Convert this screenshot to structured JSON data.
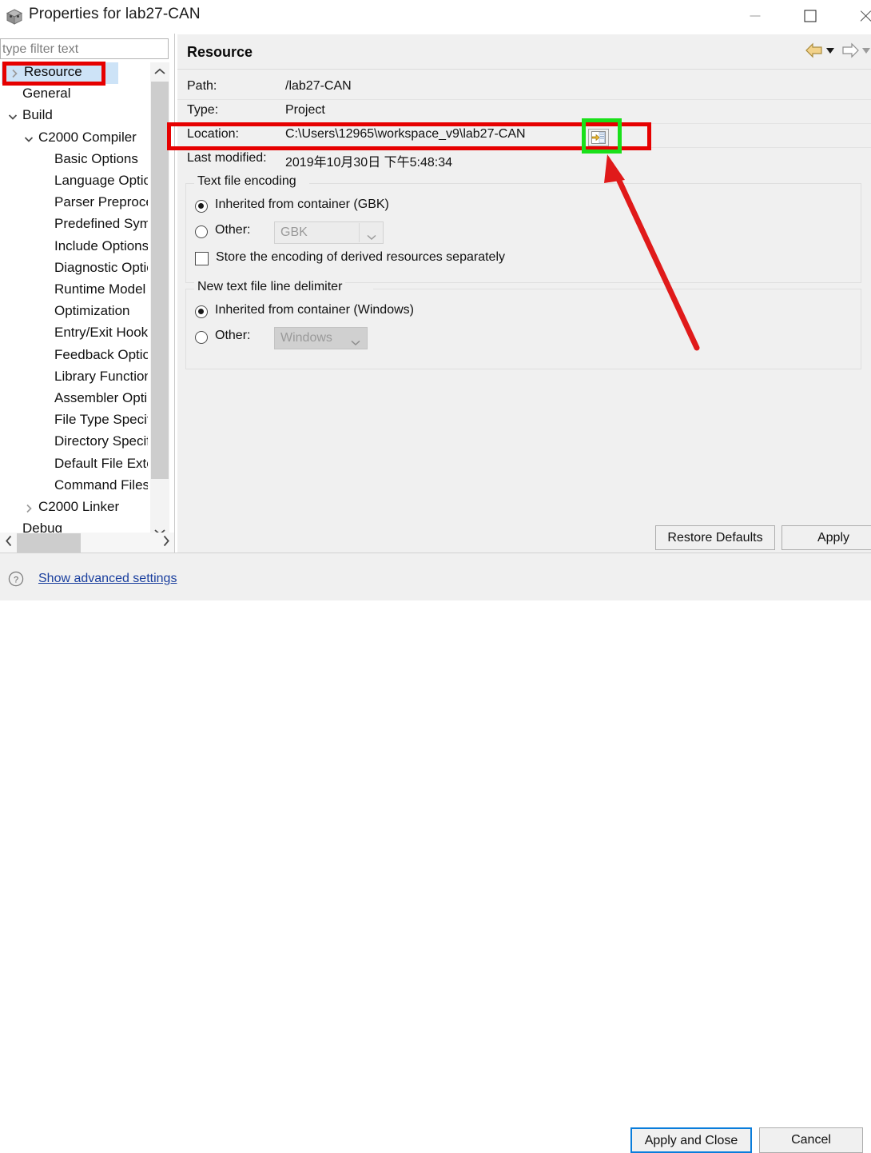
{
  "window": {
    "title": "Properties for lab27-CAN",
    "icon": "project-cube-icon",
    "controls": {
      "minimize": "minimize",
      "maximize": "maximize",
      "close": "close"
    }
  },
  "filter": {
    "placeholder": "type filter text",
    "value": ""
  },
  "tree": {
    "selected": "Resource",
    "items": [
      {
        "label": "Resource",
        "indent": 0,
        "twisty": "right",
        "selected": true
      },
      {
        "label": "General",
        "indent": 0,
        "twisty": "none",
        "selected": false
      },
      {
        "label": "Build",
        "indent": 0,
        "twisty": "down",
        "selected": false
      },
      {
        "label": "C2000 Compiler",
        "indent": 1,
        "twisty": "down",
        "selected": false
      },
      {
        "label": "Basic Options",
        "indent": 2,
        "twisty": "none",
        "selected": false
      },
      {
        "label": "Language Options",
        "indent": 2,
        "twisty": "none",
        "selected": false
      },
      {
        "label": "Parser Preprocessing",
        "indent": 2,
        "twisty": "none",
        "selected": false
      },
      {
        "label": "Predefined Symbols",
        "indent": 2,
        "twisty": "none",
        "selected": false
      },
      {
        "label": "Include Options",
        "indent": 2,
        "twisty": "none",
        "selected": false
      },
      {
        "label": "Diagnostic Options",
        "indent": 2,
        "twisty": "none",
        "selected": false
      },
      {
        "label": "Runtime Model Options",
        "indent": 2,
        "twisty": "none",
        "selected": false
      },
      {
        "label": "Optimization",
        "indent": 2,
        "twisty": "none",
        "selected": false
      },
      {
        "label": "Entry/Exit Hook Options",
        "indent": 2,
        "twisty": "none",
        "selected": false
      },
      {
        "label": "Feedback Options",
        "indent": 2,
        "twisty": "none",
        "selected": false
      },
      {
        "label": "Library Function Assumptions",
        "indent": 2,
        "twisty": "none",
        "selected": false
      },
      {
        "label": "Assembler Options",
        "indent": 2,
        "twisty": "none",
        "selected": false
      },
      {
        "label": "File Type Specifier",
        "indent": 2,
        "twisty": "none",
        "selected": false
      },
      {
        "label": "Directory Specifier",
        "indent": 2,
        "twisty": "none",
        "selected": false
      },
      {
        "label": "Default File Extensions",
        "indent": 2,
        "twisty": "none",
        "selected": false
      },
      {
        "label": "Command Files",
        "indent": 2,
        "twisty": "none",
        "selected": false
      },
      {
        "label": "C2000 Linker",
        "indent": 1,
        "twisty": "right",
        "selected": false
      },
      {
        "label": "Debug",
        "indent": 0,
        "twisty": "none",
        "selected": false
      }
    ]
  },
  "content": {
    "title": "Resource",
    "nav": {
      "back": "back-arrow",
      "back_menu": "back-dropdown",
      "forward": "forward-arrow",
      "forward_menu": "forward-dropdown"
    },
    "fields": [
      {
        "key": "Path:",
        "value": "/lab27-CAN"
      },
      {
        "key": "Type:",
        "value": "Project"
      },
      {
        "key": "Location:",
        "value": "C:\\Users\\12965\\workspace_v9\\lab27-CAN"
      },
      {
        "key": "Last modified:",
        "value": "2019年10月30日 下午5:48:34"
      }
    ],
    "location_browse_button": "browse-location-button",
    "encoding_group": {
      "legend": "Text file encoding",
      "inherited_label": "Inherited from container (GBK)",
      "inherited_selected": true,
      "other_label": "Other:",
      "other_selected": false,
      "other_value": "GBK",
      "store_checkbox_label": "Store the encoding of derived resources separately",
      "store_checked": false
    },
    "delimiter_group": {
      "legend": "New text file line delimiter",
      "inherited_label": "Inherited from container (Windows)",
      "inherited_selected": true,
      "other_label": "Other:",
      "other_selected": false,
      "other_value": "Windows"
    },
    "restore_defaults_label": "Restore Defaults",
    "apply_label": "Apply"
  },
  "footer": {
    "help_icon": "question-mark-icon",
    "advanced_link": "Show advanced settings",
    "apply_and_close_label": "Apply and Close",
    "cancel_label": "Cancel"
  },
  "annotations": {
    "colors": {
      "red": "#e60000",
      "green": "#1ae01a"
    },
    "boxes": [
      {
        "name": "resource-tree-item-highlight",
        "color": "#e60000"
      },
      {
        "name": "location-row-highlight",
        "color": "#e60000"
      },
      {
        "name": "browse-button-highlight",
        "color": "#1ae01a"
      }
    ],
    "arrow": {
      "name": "pointer-arrow-to-browse-button",
      "color": "#e60000"
    }
  }
}
